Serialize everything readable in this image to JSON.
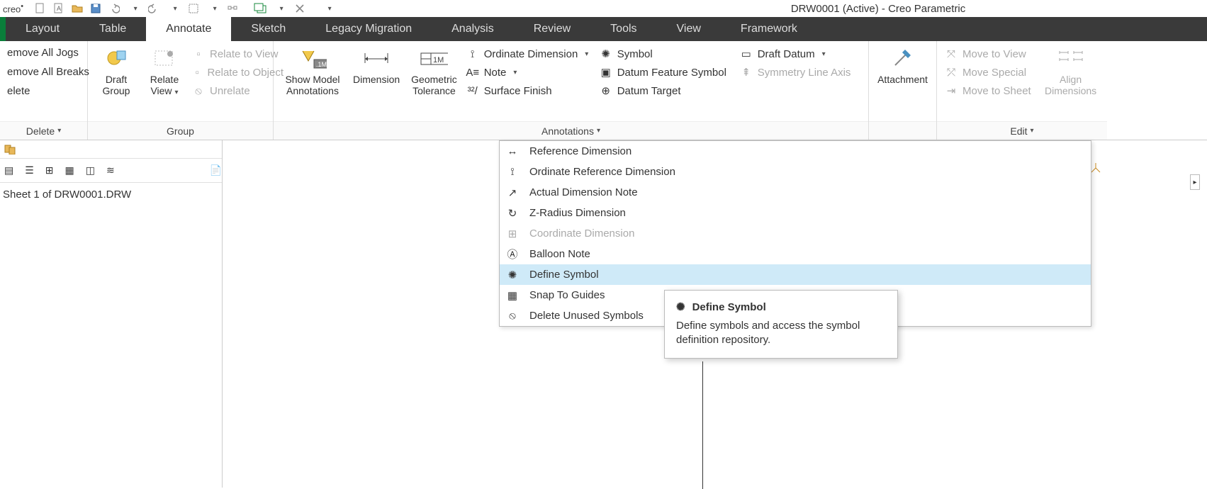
{
  "app": {
    "logo": "creo",
    "title": "DRW0001 (Active) - Creo Parametric"
  },
  "tabs": [
    "Layout",
    "Table",
    "Annotate",
    "Sketch",
    "Legacy Migration",
    "Analysis",
    "Review",
    "Tools",
    "View",
    "Framework"
  ],
  "activeTab": "Annotate",
  "ribbon": {
    "delete": {
      "items": [
        "emove All Jogs",
        "emove All Breaks",
        "elete"
      ],
      "label": "Delete"
    },
    "group": {
      "draftGroup": "Draft\nGroup",
      "relateView": "Relate\nView",
      "relateToView": "Relate to View",
      "relateToObject": "Relate to Object",
      "unrelate": "Unrelate",
      "label": "Group"
    },
    "annotations": {
      "showModel": "Show Model\nAnnotations",
      "dimension": "Dimension",
      "geomTol": "Geometric\nTolerance",
      "ordinate": "Ordinate Dimension",
      "note": "Note",
      "surfaceFinish": "Surface Finish",
      "symbol": "Symbol",
      "datumFeature": "Datum Feature Symbol",
      "datumTarget": "Datum Target",
      "draftDatum": "Draft Datum",
      "symmetryLine": "Symmetry Line Axis",
      "label": "Annotations"
    },
    "attachment": "Attachment",
    "edit": {
      "moveToView": "Move to View",
      "moveSpecial": "Move Special",
      "moveToSheet": "Move to Sheet",
      "alignDims": "Align\nDimensions",
      "label": "Edit"
    }
  },
  "dropdown": [
    {
      "label": "Reference Dimension",
      "disabled": false
    },
    {
      "label": "Ordinate Reference Dimension",
      "disabled": false
    },
    {
      "label": "Actual Dimension Note",
      "disabled": false
    },
    {
      "label": "Z-Radius Dimension",
      "disabled": false
    },
    {
      "label": "Coordinate Dimension",
      "disabled": true
    },
    {
      "label": "Balloon Note",
      "disabled": false
    },
    {
      "label": "Define Symbol",
      "disabled": false,
      "hover": true
    },
    {
      "label": "Snap To Guides",
      "disabled": false
    },
    {
      "label": "Delete Unused Symbols",
      "disabled": false
    }
  ],
  "tooltip": {
    "title": "Define Symbol",
    "desc": "Define symbols and access the symbol definition repository."
  },
  "sidebar": {
    "entry": "Sheet 1 of DRW0001.DRW"
  }
}
